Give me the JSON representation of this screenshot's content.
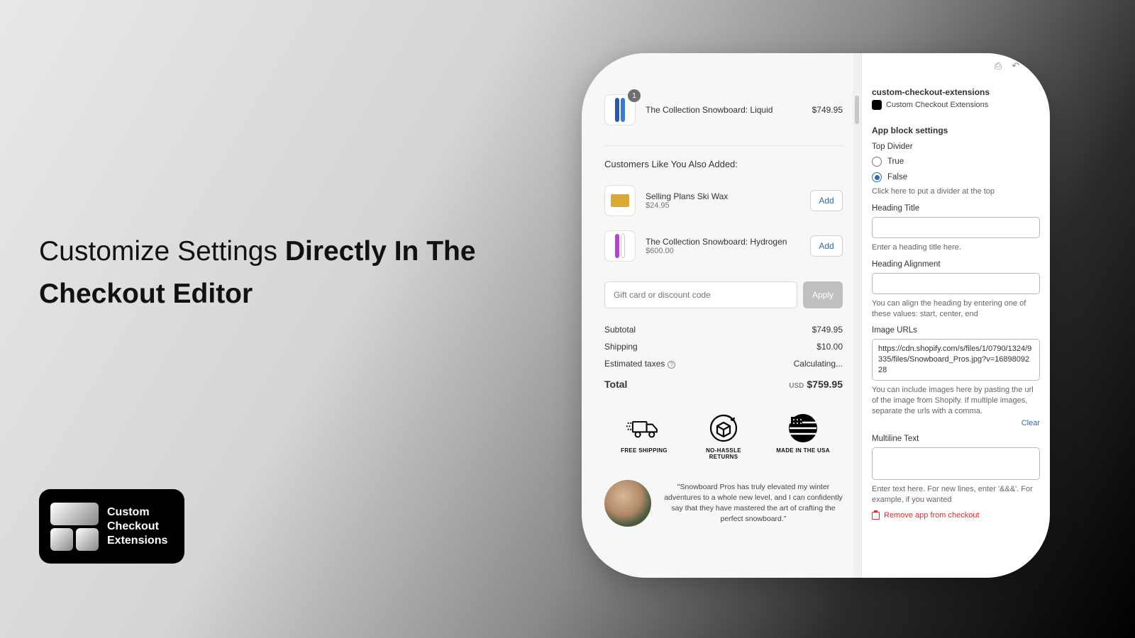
{
  "hero": {
    "part1": "Customize Settings ",
    "part2_bold": "Directly In The Checkout Editor"
  },
  "logo": {
    "line1": "Custom",
    "line2": "Checkout",
    "line3": "Extensions"
  },
  "preview": {
    "cart_item": {
      "name": "The Collection Snowboard: Liquid",
      "price": "$749.95",
      "qty_badge": "1"
    },
    "recs_title": "Customers Like You Also Added:",
    "recs": [
      {
        "name": "Selling Plans Ski Wax",
        "price": "$24.95",
        "add": "Add"
      },
      {
        "name": "The Collection Snowboard: Hydrogen",
        "price": "$600.00",
        "add": "Add"
      }
    ],
    "discount_placeholder": "Gift card or discount code",
    "apply": "Apply",
    "totals": {
      "subtotal_label": "Subtotal",
      "subtotal_value": "$749.95",
      "shipping_label": "Shipping",
      "shipping_value": "$10.00",
      "taxes_label": "Estimated taxes",
      "taxes_value": "Calculating...",
      "total_label": "Total",
      "total_currency": "USD",
      "total_value": "$759.95"
    },
    "badges": [
      {
        "label": "FREE SHIPPING"
      },
      {
        "label": "NO-HASSLE RETURNS"
      },
      {
        "label": "MADE IN THE USA"
      }
    ],
    "testimonial": "\"Snowboard Pros has truly elevated my winter adventures to a whole new level, and I can confidently say that they have mastered the art of crafting the perfect snowboard.\""
  },
  "settings": {
    "ext_name": "custom-checkout-extensions",
    "ext_sub": "Custom Checkout Extensions",
    "section": "App block settings",
    "top_divider": {
      "label": "Top Divider",
      "true": "True",
      "false": "False",
      "selected": "False",
      "help": "Click here to put a divider at the top"
    },
    "heading_title": {
      "label": "Heading Title",
      "help": "Enter a heading title here."
    },
    "heading_align": {
      "label": "Heading Alignment",
      "help": "You can align the heading by entering one of these values: start, center, end"
    },
    "image_urls": {
      "label": "Image URLs",
      "value": "https://cdn.shopify.com/s/files/1/0790/1324/9335/files/Snowboard_Pros.jpg?v=1689809228",
      "help": "You can include images here by pasting the url of the image from Shopify. If multiple images, separate the urls with a comma.",
      "clear": "Clear"
    },
    "multiline": {
      "label": "Multiline Text",
      "help": "Enter text here. For new lines, enter '&&&'. For example, if you wanted"
    },
    "remove": "Remove app from checkout"
  }
}
